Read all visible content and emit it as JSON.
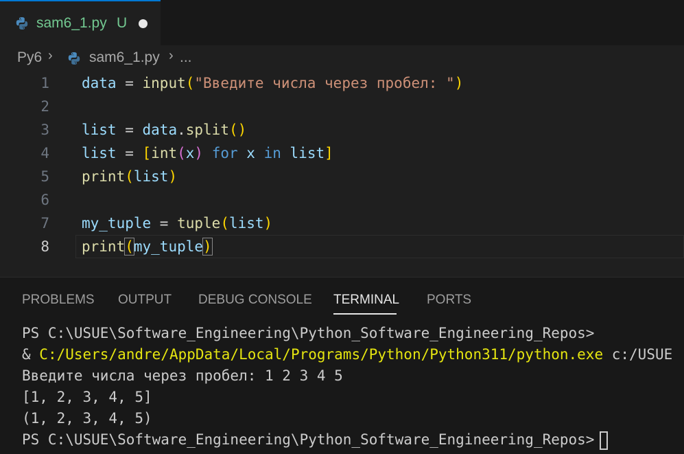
{
  "tab": {
    "filename": "sam6_1.py",
    "status": "U",
    "dirty": true
  },
  "breadcrumb": {
    "folder": "Py6",
    "file": "sam6_1.py",
    "more": "..."
  },
  "editor": {
    "line_numbers": [
      "1",
      "2",
      "3",
      "4",
      "5",
      "6",
      "7",
      "8"
    ],
    "active_line": 8,
    "lines": [
      [
        {
          "t": "data",
          "c": "var"
        },
        {
          "t": " = ",
          "c": "plain"
        },
        {
          "t": "input",
          "c": "fn"
        },
        {
          "t": "(",
          "c": "b1"
        },
        {
          "t": "\"Введите числа через пробел: \"",
          "c": "str"
        },
        {
          "t": ")",
          "c": "b1"
        }
      ],
      [],
      [
        {
          "t": "list",
          "c": "var"
        },
        {
          "t": " = ",
          "c": "plain"
        },
        {
          "t": "data",
          "c": "var"
        },
        {
          "t": ".",
          "c": "plain"
        },
        {
          "t": "split",
          "c": "fn"
        },
        {
          "t": "()",
          "c": "b1"
        }
      ],
      [
        {
          "t": "list",
          "c": "var"
        },
        {
          "t": " = ",
          "c": "plain"
        },
        {
          "t": "[",
          "c": "b1"
        },
        {
          "t": "int",
          "c": "fn"
        },
        {
          "t": "(",
          "c": "b2"
        },
        {
          "t": "x",
          "c": "var"
        },
        {
          "t": ")",
          "c": "b2"
        },
        {
          "t": " for ",
          "c": "kw"
        },
        {
          "t": "x",
          "c": "var"
        },
        {
          "t": " in ",
          "c": "kw"
        },
        {
          "t": "list",
          "c": "var"
        },
        {
          "t": "]",
          "c": "b1"
        }
      ],
      [
        {
          "t": "print",
          "c": "fn"
        },
        {
          "t": "(",
          "c": "b1"
        },
        {
          "t": "list",
          "c": "var"
        },
        {
          "t": ")",
          "c": "b1"
        }
      ],
      [],
      [
        {
          "t": "my_tuple",
          "c": "var"
        },
        {
          "t": " = ",
          "c": "plain"
        },
        {
          "t": "tuple",
          "c": "fn"
        },
        {
          "t": "(",
          "c": "b1"
        },
        {
          "t": "list",
          "c": "var"
        },
        {
          "t": ")",
          "c": "b1"
        }
      ],
      [
        {
          "t": "print",
          "c": "fn"
        },
        {
          "t": "(",
          "c": "b1",
          "m": true
        },
        {
          "t": "my_tuple",
          "c": "var"
        },
        {
          "t": ")",
          "c": "b1",
          "m": true
        }
      ]
    ]
  },
  "panel": {
    "tabs": [
      "PROBLEMS",
      "OUTPUT",
      "DEBUG CONSOLE",
      "TERMINAL",
      "PORTS"
    ],
    "active_tab": "TERMINAL"
  },
  "terminal": {
    "prompt1": "PS C:\\USUE\\Software_Engineering\\Python_Software_Engineering_Repos>",
    "cmd_amp": "& ",
    "cmd_exe": "C:/Users/andre/AppData/Local/Programs/Python/Python311/python.exe",
    "cmd_arg": " c:/USUE",
    "out1": "Введите числа через пробел: 1 2 3 4 5",
    "out2": "[1, 2, 3, 4, 5]",
    "out3": "(1, 2, 3, 4, 5)",
    "prompt2": "PS C:\\USUE\\Software_Engineering\\Python_Software_Engineering_Repos>"
  },
  "colors": {
    "accent": "#0078d4",
    "git_untracked": "#73c991",
    "terminal_path": "#e5e510"
  },
  "icons": [
    "python-file-icon",
    "chevron-right-icon",
    "terminal-cursor"
  ]
}
